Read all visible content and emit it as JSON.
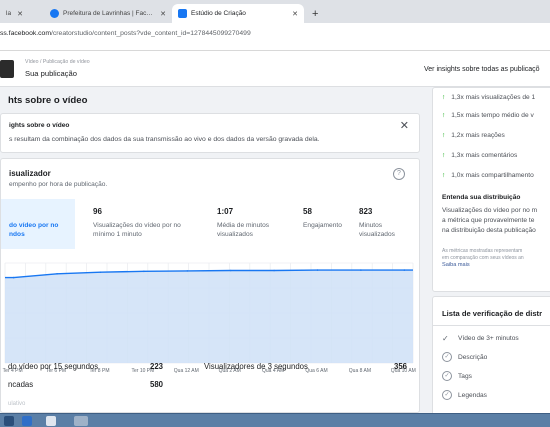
{
  "browser": {
    "tabs": [
      {
        "label": "la",
        "favicon": "",
        "active": false
      },
      {
        "label": "Prefeitura de Lavrinhas | Facebo",
        "favicon": "facebook-icon",
        "active": false
      },
      {
        "label": "Estúdio de Criação",
        "favicon": "creator-studio-icon",
        "active": true
      }
    ],
    "new_tab": "+",
    "url_host": "ss.facebook.com",
    "url_path": "/creatorstudio/content_posts?vde_content_id=1278445099270499"
  },
  "header": {
    "breadcrumb": "Vídeo / Publicação de vídeo",
    "title": "Sua publicação",
    "all_insights_link": "Ver insights sobre todas as publicaçõ"
  },
  "main": {
    "section_title": "hts sobre o vídeo",
    "info_card": {
      "title": "ights sobre o vídeo",
      "description": "s resultam da combinação dos dados da sua transmissão ao vivo e dos dados da versão gravada dela."
    },
    "viewers_card": {
      "title": "isualizador",
      "subtitle": "empenho por hora de publicação.",
      "help_icon": "?",
      "selected_metric": "do vídeo por no\nndos",
      "metrics": [
        {
          "value": "96",
          "label": "Visualizações do vídeo por no\nmínimo 1 minuto"
        },
        {
          "value": "1:07",
          "label": "Média de minutos\nvisualizados"
        },
        {
          "value": "58",
          "label": "Engajamento"
        },
        {
          "value": "823",
          "label": "Minutos\nvisualizados"
        }
      ],
      "x_ticks": [
        "Ter 4 PM",
        "Ter 6 PM",
        "Ter 8 PM",
        "Ter 10 PM",
        "Qua 12 AM",
        "Qua 2 AM",
        "Qua 4 AM",
        "Qua 6 AM",
        "Qua 8 AM",
        "Qua 10 AM"
      ]
    },
    "stats": [
      {
        "label": "do vídeo por 15 segundos",
        "value": "223"
      },
      {
        "label": "ncadas",
        "value": "580"
      }
    ],
    "stat_right": {
      "label": "Visualizadores de 3 segundos",
      "value": "356"
    },
    "faded_text": "ulativo"
  },
  "sidebar": {
    "insights": [
      "1,3x mais visualizações de 1",
      "1,5x mais tempo médio de v",
      "1,2x mais reações",
      "1,3x mais comentários",
      "1,0x mais compartilhamento"
    ],
    "distribution": {
      "heading": "Entenda sua distribuição",
      "paragraph": "Visualizações do vídeo por no m\na métrica que provavelmente te\nna distribuição desta publicação",
      "note": "As métricas mostradas representam\nem comparação com seus vídeos an",
      "see_more": "Saiba mais"
    },
    "checklist": {
      "heading": "Lista de verificação de distr",
      "items": [
        {
          "label": "Vídeo de 3+ minutos",
          "done": true
        },
        {
          "label": "Descrição",
          "done": false
        },
        {
          "label": "Tags",
          "done": false
        },
        {
          "label": "Legendas",
          "done": false
        }
      ]
    }
  },
  "colors": {
    "accent": "#1877f2",
    "line": "#1877f2",
    "area": "#cfe1f7",
    "positive": "#00a400",
    "page_bg": "#f0f2f5",
    "taskbar": "#5b7fa6"
  },
  "chart_data": {
    "type": "area",
    "x": [
      "Ter 4 PM",
      "Ter 6 PM",
      "Ter 8 PM",
      "Ter 10 PM",
      "Qua 12 AM",
      "Qua 2 AM",
      "Qua 4 AM",
      "Qua 6 AM",
      "Qua 8 AM",
      "Qua 10 AM"
    ],
    "series": [
      {
        "values": [
          205,
          214,
          218,
          220,
          221,
          222,
          222,
          223,
          223,
          223
        ]
      }
    ],
    "ylim": [
      0,
      240
    ],
    "grid": true
  }
}
